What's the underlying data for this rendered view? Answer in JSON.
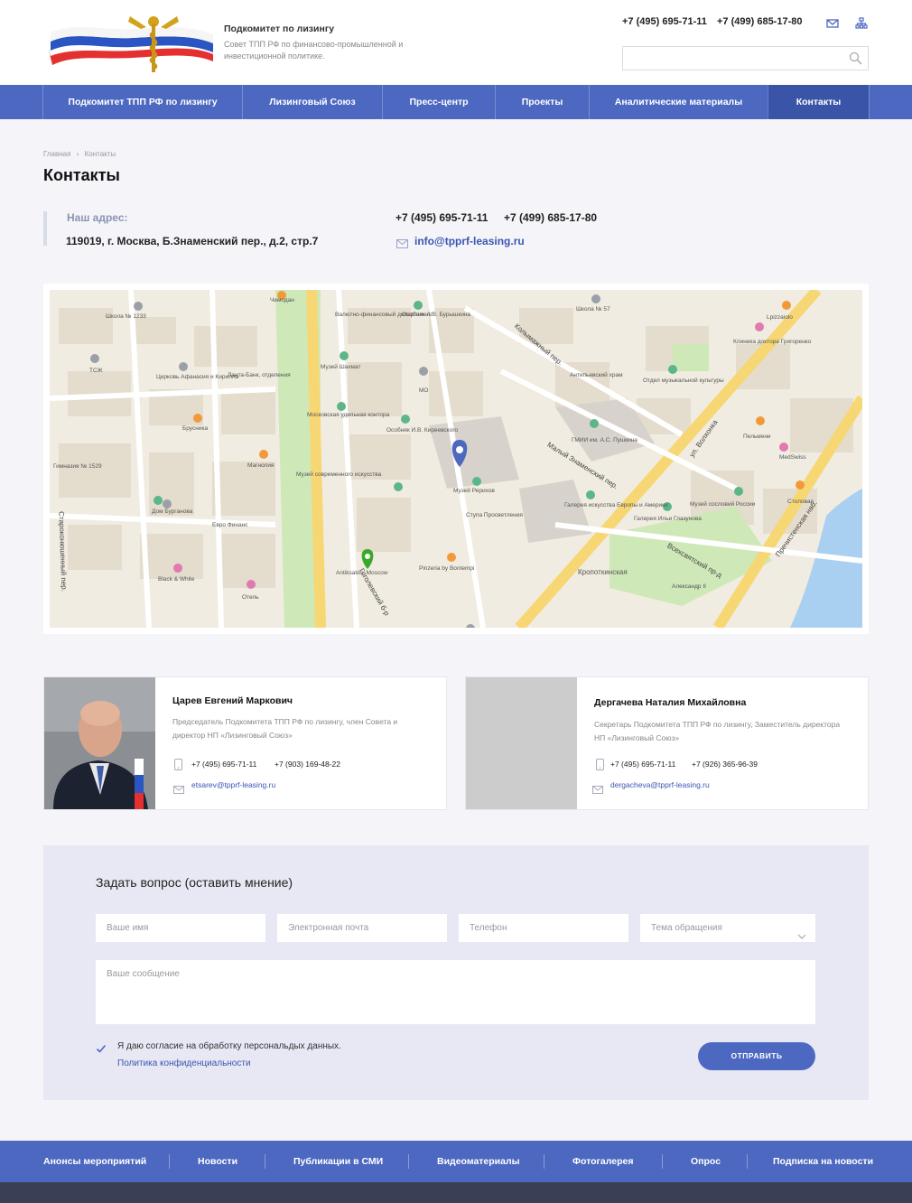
{
  "header": {
    "title": "Подкомитет по лизингу",
    "subtitle": "Совет ТПП РФ по финансово-промышленной и инвестиционной политике.",
    "phones": [
      "+7 (495) 695-71-11",
      "+7 (499) 685-17-80"
    ],
    "icons": [
      "mail-icon",
      "sitemap-icon",
      "search-icon"
    ],
    "search_placeholder": ""
  },
  "nav": {
    "items": [
      {
        "label": "Подкомитет ТПП РФ по лизингу",
        "active": false
      },
      {
        "label": "Лизинговый Союз",
        "active": false
      },
      {
        "label": "Пресс-центр",
        "active": false
      },
      {
        "label": "Проекты",
        "active": false
      },
      {
        "label": "Аналитические материалы",
        "active": false
      },
      {
        "label": "Контакты",
        "active": true
      }
    ]
  },
  "breadcrumb": [
    "Главная",
    "Контакты"
  ],
  "page_title": "Контакты",
  "contacts": {
    "address_label": "Наш адрес:",
    "address": "119019, г. Москва, Б.Знаменский пер., д.2, стр.7",
    "phones": [
      "+7 (495) 695-71-11",
      "+7 (499) 685-17-80"
    ],
    "email": "info@tpprf-leasing.ru"
  },
  "map": {
    "labels": [
      "Школа № 1233",
      "Чемодан",
      "Валютно-финансовый департамент",
      "Особняк А.В. Бурышкина",
      "Школа № 57",
      "Lpizzaiolo",
      "Клиника доктора Григоренко",
      "ТСЖ",
      "Церковь Афанасия и Кирилла",
      "Ланта-Банк, отделения",
      "Музей Шахмат",
      "МО",
      "Антипьевский храм",
      "Отдел музыкальной культуры",
      "Московская удельная контора",
      "Особняк И.В. Киреевского",
      "Брусника",
      "Пельмени",
      "MedSwiss",
      "Гимназия № 1529",
      "Магнолия",
      "Музей современного искусства",
      "ГМИИ им. А.С. Пушкина",
      "Музей Рерихов",
      "Дом Бурганова",
      "Евро Финанс",
      "Ступа Просветления",
      "Галерея искусства Европы и Америки",
      "Галерея Ильи Глазунова",
      "Музей сословий России",
      "Столовая",
      "Antiksalon. Moscow",
      "Pinzeria by Bontempi",
      "Кропоткинская",
      "Александр II",
      "Black & White",
      "Отель"
    ],
    "streets": [
      "Колымажный пер.",
      "Малый Знаменский пер.",
      "ул. Волхонка",
      "Гоголевский б-р",
      "Пречистенская наб.",
      "Всехсвятский пр-д",
      "Староконюшенный пер."
    ]
  },
  "people": [
    {
      "name": "Царев Евгений Маркович",
      "role": "Председатель Подкомитета ТПП РФ по лизингу, член Совета и директор НП «Лизинговый Союз»",
      "phone1": "+7 (495) 695-71-11",
      "phone2": "+7 (903) 169-48-22",
      "email": "etsarev@tpprf-leasing.ru"
    },
    {
      "name": "Дергачева Наталия Михайловна",
      "role": "Секретарь Подкомитета ТПП РФ по лизингу, Заместитель директора НП «Лизинговый Союз»",
      "phone1": "+7 (495) 695-71-11",
      "phone2": "+7 (926) 365-96-39",
      "email": "dergacheva@tpprf-leasing.ru"
    }
  ],
  "form": {
    "title": "Задать вопрос (оставить мнение)",
    "name_placeholder": "Ваше имя",
    "email_placeholder": "Электронная почта",
    "phone_placeholder": "Телефон",
    "topic_placeholder": "Тема обращения",
    "message_placeholder": "Ваше сообщение",
    "consent_checked": true,
    "consent_text": "Я даю согласие на обработку персональдых данных.",
    "policy_link": "Политика конфиденциальности",
    "submit_label": "ОТПРАВИТЬ"
  },
  "footer": {
    "items": [
      "Анонсы мероприятий",
      "Новости",
      "Публикации в СМИ",
      "Видеоматериалы",
      "Фотогалерея",
      "Опрос",
      "Подписка на новости"
    ]
  },
  "colors": {
    "primary": "#4c68c0",
    "primary_dark": "#3a55a8",
    "link": "#3a56b0",
    "footer_dark": "#3b3f55"
  }
}
